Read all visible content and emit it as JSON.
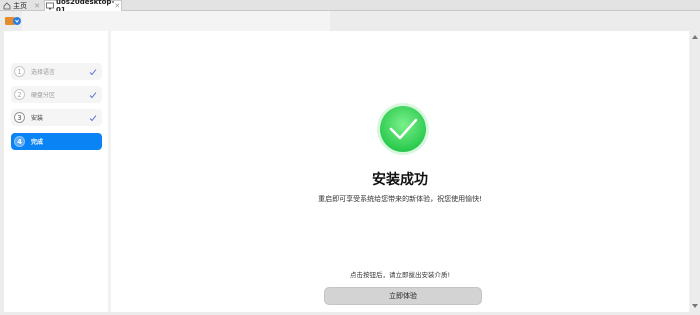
{
  "tabs": [
    {
      "label": "主页",
      "icon": "home-icon"
    },
    {
      "label": "uos20desktop-01",
      "icon": "vm-icon"
    }
  ],
  "sidebar": {
    "steps": [
      {
        "number": "1",
        "label": "选择语言",
        "done": true
      },
      {
        "number": "2",
        "label": "硬盘分区",
        "done": true
      },
      {
        "number": "3",
        "label": "安装",
        "done": true
      },
      {
        "number": "4",
        "label": "完成",
        "done": false
      }
    ]
  },
  "main": {
    "title": "安装成功",
    "subtitle": "重启即可享受系统给您带来的新体验，祝您使用愉快!",
    "hint": "点击按钮后，请立即拔出安装介质!",
    "button_label": "立即体验"
  },
  "colors": {
    "accent": "#0a84f5",
    "success": "#3ddc5a",
    "check": "#5b6fd6"
  }
}
